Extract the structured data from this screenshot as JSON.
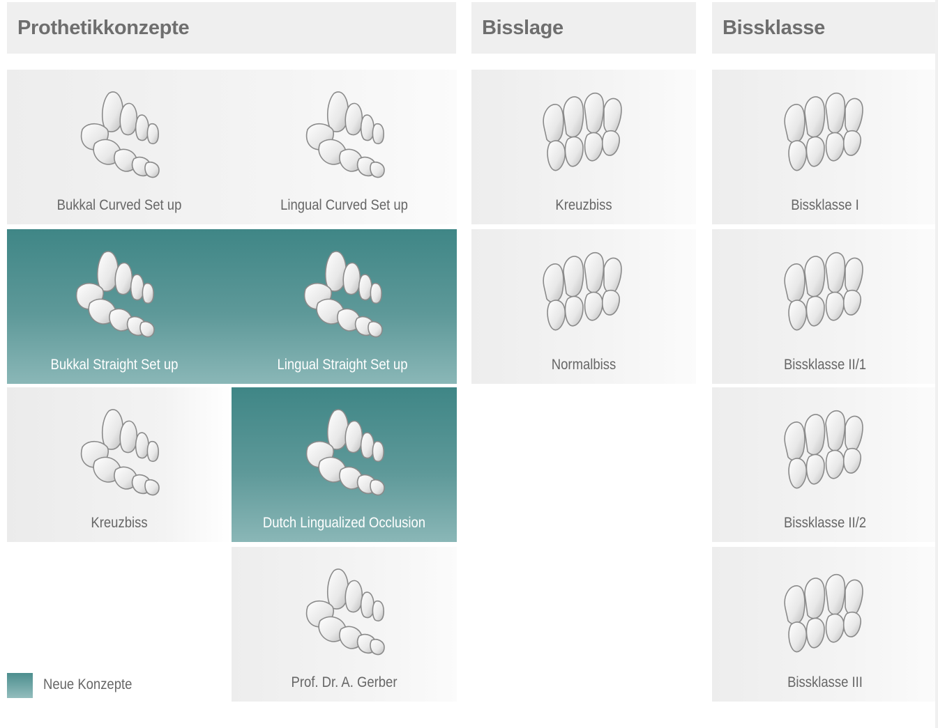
{
  "headers": {
    "prothetik": "Prothetikkonzepte",
    "bisslage": "Bisslage",
    "bissklasse": "Bissklasse"
  },
  "prothetik": {
    "bukkal_curved": "Bukkal Curved Set up",
    "lingual_curved": "Lingual Curved Set up",
    "bukkal_straight": "Bukkal Straight Set up",
    "lingual_straight": "Lingual Straight Set up",
    "kreuzbiss": "Kreuzbiss",
    "dutch": "Dutch Lingualized Occlusion",
    "gerber": "Prof. Dr. A. Gerber"
  },
  "bisslage": {
    "kreuzbiss": "Kreuzbiss",
    "normalbiss": "Normalbiss"
  },
  "bissklasse": {
    "k1": "Bissklasse I",
    "k2_1": "Bissklasse II/1",
    "k2_2": "Bissklasse II/2",
    "k3": "Bissklasse III"
  },
  "legend": {
    "label": "Neue Konzepte",
    "color": "#4c8e8e"
  },
  "colors": {
    "teal_top": "#3f8686",
    "teal_bottom": "#8ab7b7",
    "header_bg": "#efefef",
    "header_text": "#6e6e6e"
  }
}
